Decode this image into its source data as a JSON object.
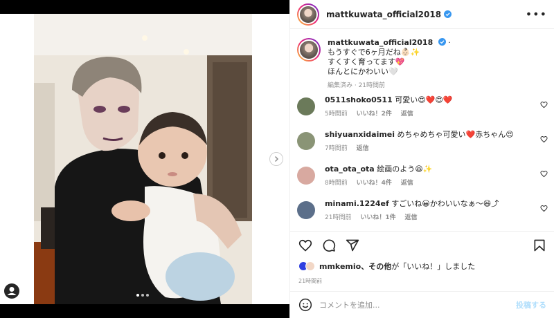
{
  "post": {
    "username": "mattkuwata_official2018",
    "caption_line1": "もうすぐで6ヶ月だね👶🏻✨",
    "caption_line2": "すくすく育ってます💖",
    "caption_line3": "ほんとにかわいい🤍",
    "caption_meta": "編集済み · 21時間前",
    "liked_by_user": "mmkemio",
    "liked_by_rest": "、その他",
    "liked_by_suffix": "が「いいね！」しました",
    "time": "21時間前"
  },
  "comments": [
    {
      "user": "0511shoko0511",
      "text": "可愛い😍❤️😍❤️",
      "time": "5時間前",
      "likes": "いいね！2件",
      "reply": "返信",
      "avatar_color": "#6b7a5a"
    },
    {
      "user": "shiyuanxidaimei",
      "text": "めちゃめちゃ可愛い❤️赤ちゃん😍",
      "time": "7時間前",
      "likes": "",
      "reply": "返信",
      "avatar_color": "#8a9476"
    },
    {
      "user": "ota_ota_ota",
      "text": "絵画のよう😆✨",
      "time": "8時間前",
      "likes": "いいね！4件",
      "reply": "返信",
      "avatar_color": "#d8a9a0"
    },
    {
      "user": "minami.1224ef",
      "text": "すごいね😀かわいいなぁ〜😆⤴︎",
      "time": "21時間前",
      "likes": "いいね！1件",
      "reply": "返信",
      "avatar_color": "#5c6f8a"
    }
  ],
  "composer": {
    "placeholder": "コメントを追加...",
    "post_label": "投稿する"
  },
  "icons": {
    "more": "more-options-icon",
    "like": "heart-icon",
    "comment": "comment-icon",
    "share": "share-icon",
    "save": "bookmark-icon",
    "emoji": "emoji-icon",
    "next": "chevron-right-icon"
  },
  "colors": {
    "verified": "#3897f0",
    "post_button": "#b2dffc",
    "muted": "#8e8e8e"
  },
  "carousel": {
    "total": 3,
    "current": 1
  }
}
